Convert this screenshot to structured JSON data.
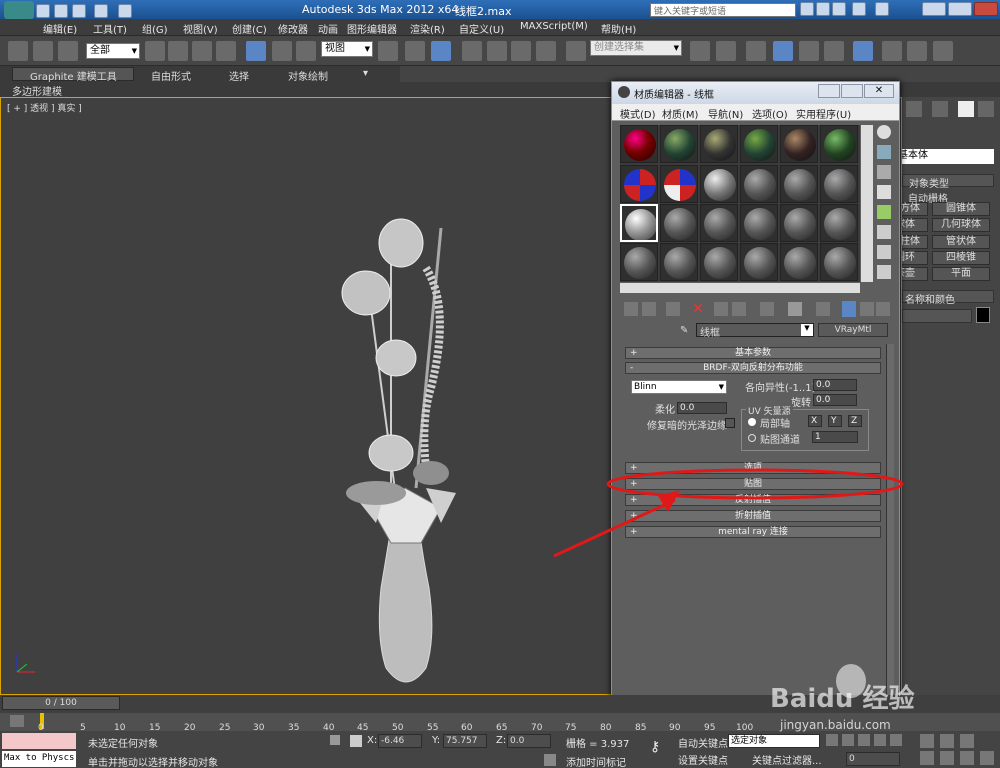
{
  "app": {
    "title": "Autodesk 3ds Max  2012 x64",
    "file": "线框2.max",
    "search_placeholder": "键入关键字或短语"
  },
  "menubar": [
    "编辑(E)",
    "工具(T)",
    "组(G)",
    "视图(V)",
    "创建(C)",
    "修改器",
    "动画",
    "图形编辑器",
    "渲染(R)",
    "自定义(U)",
    "MAXScript(M)",
    "帮助(H)"
  ],
  "toolbar": {
    "filter_select": "全部",
    "ref_coord_select": "视图",
    "selection_set": "创建选择集"
  },
  "ribbon": {
    "tabs": [
      "Graphite 建模工具",
      "自由形式",
      "选择",
      "对象绘制"
    ],
    "panel_label": "多边形建模"
  },
  "viewport": {
    "label": "[ + ] 透视 ] 真实 ]"
  },
  "material_editor": {
    "title": "材质编辑器 - 线框",
    "menu": [
      "模式(D)",
      "材质(M)",
      "导航(N)",
      "选项(O)",
      "实用程序(U)"
    ],
    "material_name": "线框",
    "material_type": "VRayMtl",
    "rollouts": {
      "basic_params": "基本参数",
      "brdf": "BRDF-双向反射分布功能",
      "options": "选项",
      "maps": "贴图",
      "reflect_interp": "反射插值",
      "refract_interp": "折射插值",
      "mental_ray": "mental ray 连接"
    },
    "brdf": {
      "type": "Blinn",
      "anisotropy_label": "各向异性(-1..1)",
      "anisotropy_value": "0.0",
      "rotation_label": "旋转",
      "rotation_value": "0.0",
      "soften_label": "柔化",
      "soften_value": "0.0",
      "fix_dark_label": "修复暗的光泽边缘",
      "uv_group_label": "UV 矢量源",
      "local_axis_label": "局部轴",
      "axis_x": "X",
      "axis_y": "Y",
      "axis_z": "Z",
      "map_channel_label": "贴图通道",
      "map_channel_value": "1"
    }
  },
  "command_panel": {
    "dropdown": "标准基本体",
    "object_type_header": "对象类型",
    "autogrid": "自动栅格",
    "buttons": [
      "长方体",
      "圆锥体",
      "球体",
      "几何球体",
      "圆柱体",
      "管状体",
      "圆环",
      "四棱锥",
      "茶壶",
      "平面"
    ],
    "name_color_header": "名称和颜色"
  },
  "timeline": {
    "frame_label": "0 / 100",
    "ticks": [
      "0",
      "5",
      "10",
      "15",
      "20",
      "25",
      "30",
      "35",
      "40",
      "45",
      "50",
      "55",
      "60",
      "65",
      "70",
      "75",
      "80",
      "85",
      "90",
      "95",
      "100"
    ]
  },
  "status": {
    "script_listener": "Max to Physcs",
    "selection_status": "未选定任何对象",
    "prompt": "单击并拖动以选择并移动对象",
    "x_label": "X:",
    "x_value": "-6.46",
    "y_label": "Y:",
    "y_value": "75.757",
    "z_label": "Z:",
    "z_value": "0.0",
    "grid": "栅格 = 3.937",
    "add_time_tag": "添加时间标记",
    "auto_key": "自动关键点",
    "set_key": "设置关键点",
    "selected_object": "选定对象",
    "key_filter": "关键点过滤器...",
    "frame_value": "0"
  },
  "watermark": {
    "brand": "Baidu 经验",
    "url": "jingyan.baidu.com"
  }
}
